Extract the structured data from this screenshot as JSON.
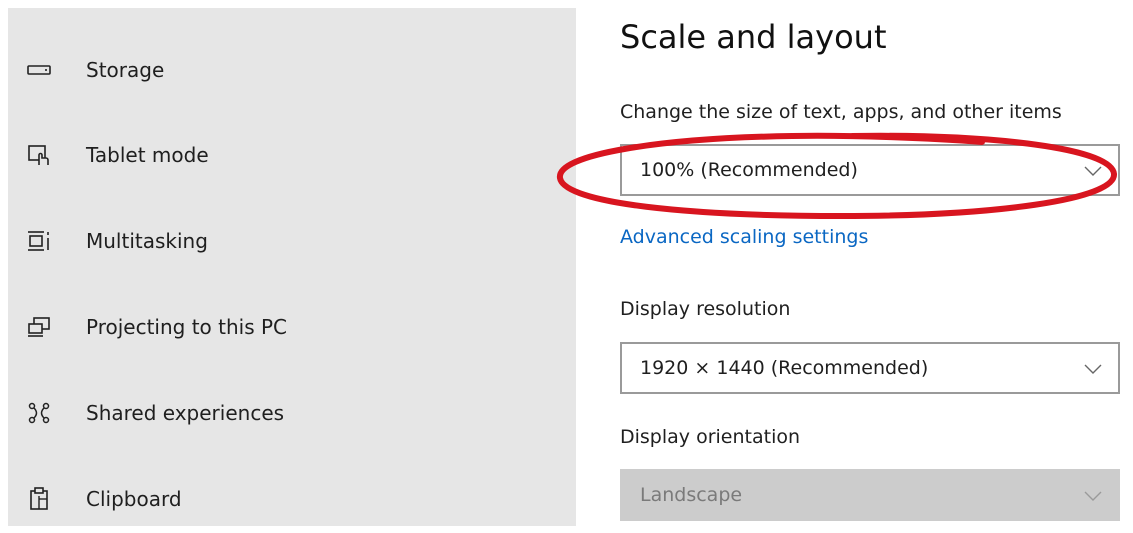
{
  "sidebar": {
    "items": [
      {
        "label": "Storage",
        "icon": "storage-icon"
      },
      {
        "label": "Tablet mode",
        "icon": "tablet-mode-icon"
      },
      {
        "label": "Multitasking",
        "icon": "multitasking-icon"
      },
      {
        "label": "Projecting to this PC",
        "icon": "projecting-icon"
      },
      {
        "label": "Shared experiences",
        "icon": "shared-experiences-icon"
      },
      {
        "label": "Clipboard",
        "icon": "clipboard-icon"
      }
    ]
  },
  "main": {
    "title": "Scale and layout",
    "scale_label": "Change the size of text, apps, and other items",
    "scale_value": "100% (Recommended)",
    "advanced_link": "Advanced scaling settings",
    "resolution_label": "Display resolution",
    "resolution_value": "1920 × 1440 (Recommended)",
    "orientation_label": "Display orientation",
    "orientation_value": "Landscape"
  },
  "colors": {
    "sidebar_bg": "#e6e6e6",
    "link": "#0a67c3",
    "annotation_red": "#d8151f"
  }
}
